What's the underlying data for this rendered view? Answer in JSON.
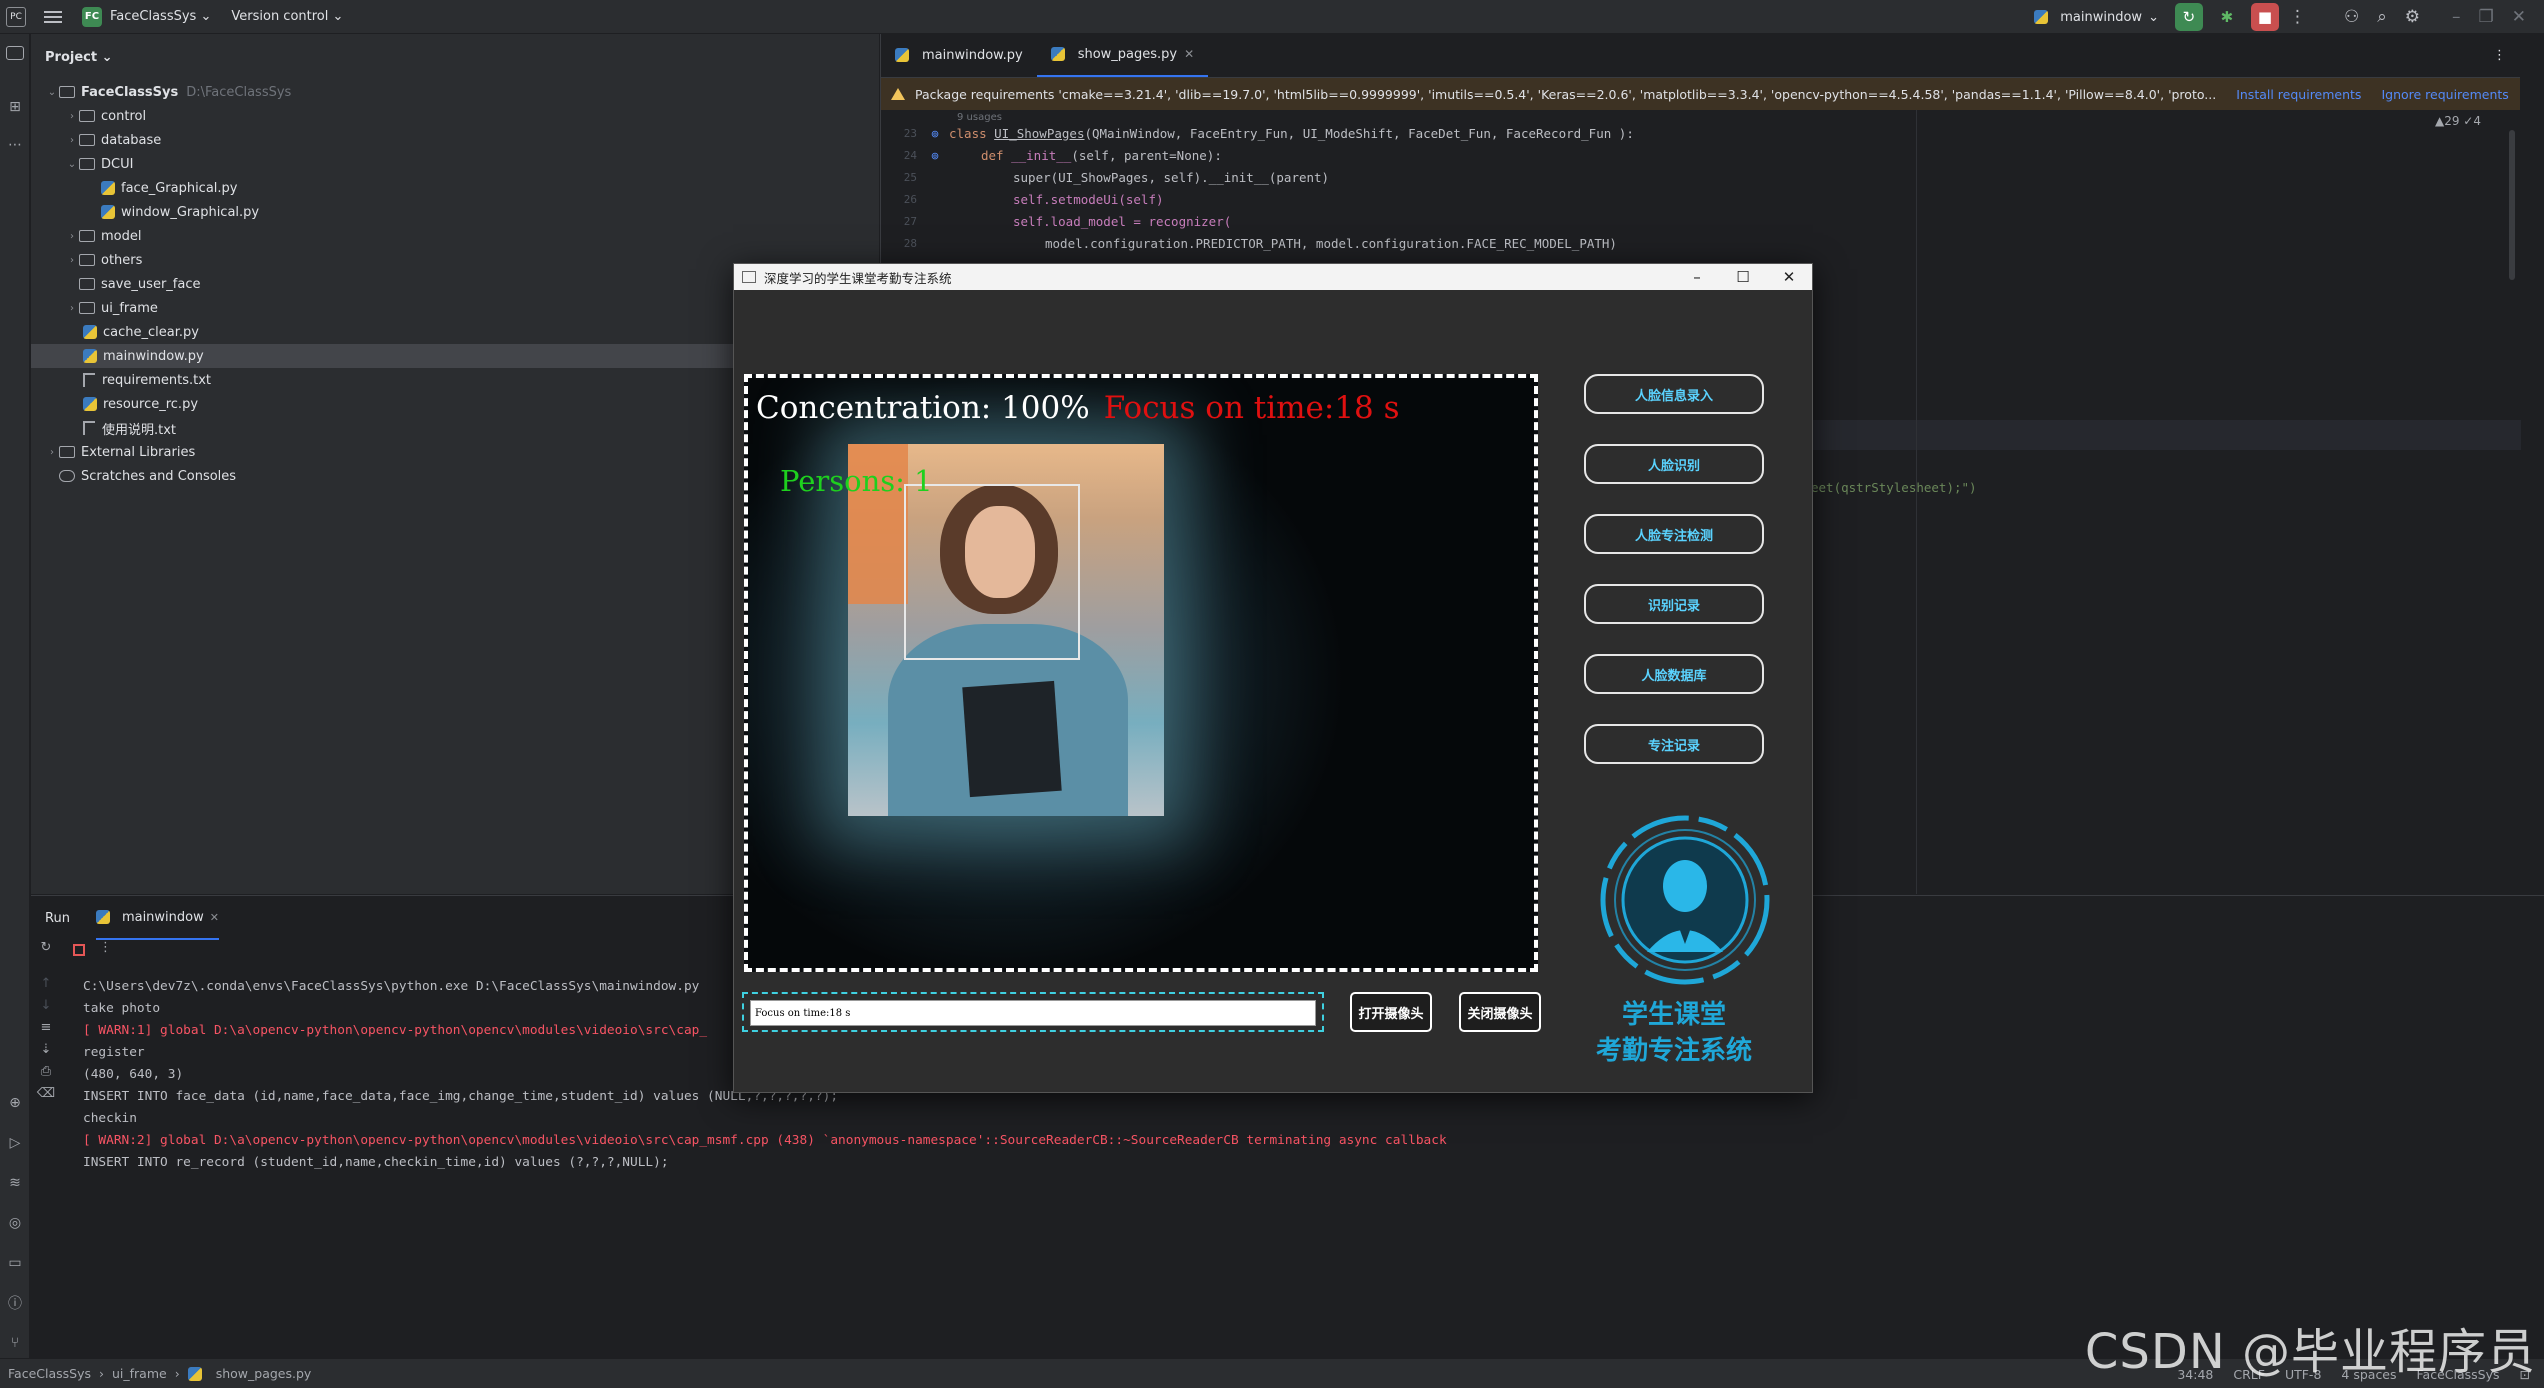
{
  "titlebar": {
    "app_icon": "PC",
    "project_badge": "FC",
    "project_name": "FaceClassSys",
    "version_control": "Version control",
    "run_config": "mainwindow"
  },
  "project_panel": {
    "header": "Project",
    "root_name": "FaceClassSys",
    "root_path": "D:\\FaceClassSys",
    "items": [
      {
        "label": "control",
        "type": "folder"
      },
      {
        "label": "database",
        "type": "folder"
      },
      {
        "label": "DCUI",
        "type": "folder"
      },
      {
        "label": "face_Graphical.py",
        "type": "py"
      },
      {
        "label": "window_Graphical.py",
        "type": "py"
      },
      {
        "label": "model",
        "type": "folder"
      },
      {
        "label": "others",
        "type": "folder"
      },
      {
        "label": "save_user_face",
        "type": "folder"
      },
      {
        "label": "ui_frame",
        "type": "folder"
      },
      {
        "label": "cache_clear.py",
        "type": "py"
      },
      {
        "label": "mainwindow.py",
        "type": "py"
      },
      {
        "label": "requirements.txt",
        "type": "txt"
      },
      {
        "label": "resource_rc.py",
        "type": "py"
      },
      {
        "label": "使用说明.txt",
        "type": "txt"
      }
    ],
    "external_libraries": "External Libraries",
    "scratches": "Scratches and Consoles"
  },
  "editor": {
    "tabs": [
      {
        "label": "mainwindow.py"
      },
      {
        "label": "show_pages.py"
      }
    ],
    "banner": {
      "text": "Package requirements 'cmake==3.21.4', 'dlib==19.7.0', 'html5lib==0.9999999', 'imutils==0.5.4', 'Keras==2.0.6', 'matplotlib==3.3.4', 'opencv-python==4.5.4.58', 'pandas==1.1.4', 'Pillow==8.4.0', 'proto...",
      "install": "Install requirements",
      "ignore": "Ignore requirements"
    },
    "inspection": "▲29 ✓4",
    "usages": "9 usages",
    "code": {
      "l1_kw": "class ",
      "l1_name": "UI_ShowPages",
      "l1_rest": "(QMainWindow, FaceEntry_Fun, UI_ModeShift, FaceDet_Fun, FaceRecord_Fun ):",
      "l2_kw": "def ",
      "l2_name": "__init__",
      "l2_self": "(self, parent=None):",
      "l3": "super(UI_ShowPages, self).__init__(parent)",
      "l4": "self.setmodeUi(self)",
      "l5": "self.load_model = recognizer(",
      "l6": "model.configuration.PREDICTOR_PATH, model.configuration.FACE_REC_MODEL_PATH)",
      "stylesheet_fragment": "eet(qstrStylesheet);\")"
    },
    "line_numbers": [
      "23",
      "24",
      "25",
      "26",
      "27",
      "28"
    ]
  },
  "run_panel": {
    "label": "Run",
    "tab": "mainwindow",
    "console": [
      {
        "text": "C:\\Users\\dev7z\\.conda\\envs\\FaceClassSys\\python.exe D:\\FaceClassSys\\mainwindow.py",
        "kind": "ok"
      },
      {
        "text": "take photo",
        "kind": "ok"
      },
      {
        "text": "[ WARN:1] global D:\\a\\opencv-python\\opencv-python\\opencv\\modules\\videoio\\src\\cap_",
        "kind": "err"
      },
      {
        "text": "register",
        "kind": "ok"
      },
      {
        "text": "(480, 640, 3)",
        "kind": "ok"
      },
      {
        "text": "INSERT INTO face_data (id,name,face_data,face_img,change_time,student_id) values (NULL,?,?,?,?,?);",
        "kind": "ok"
      },
      {
        "text": "checkin",
        "kind": "ok"
      },
      {
        "text": "[ WARN:2] global D:\\a\\opencv-python\\opencv-python\\opencv\\modules\\videoio\\src\\cap_msmf.cpp (438) `anonymous-namespace'::SourceReaderCB::~SourceReaderCB terminating async callback",
        "kind": "err"
      },
      {
        "text": "INSERT INTO re_record (student_id,name,checkin_time,id) values (?,?,?,NULL);",
        "kind": "ok"
      }
    ]
  },
  "statusbar": {
    "crumb1": "FaceClassSys",
    "crumb2": "ui_frame",
    "crumb3": "show_pages.py",
    "position": "34:48",
    "line_sep": "CRLF",
    "encoding": "UTF-8",
    "indent": "4 spaces",
    "interpreter": "FaceClassSys"
  },
  "watermark": "CSDN @毕业程序员",
  "dialog": {
    "title": "深度学习的学生课堂考勤专注系统",
    "overlay_concentration": "Concentration: 100%",
    "overlay_focus": "Focus on time:18 s",
    "overlay_persons": "Persons: 1",
    "status_text": "Focus on time:18 s",
    "open_camera": "打开摄像头",
    "close_camera": "关闭摄像头",
    "side_buttons": [
      {
        "label": "人脸信息录入"
      },
      {
        "label": "人脸识别"
      },
      {
        "label": "人脸专注检测"
      },
      {
        "label": "识别记录"
      },
      {
        "label": "人脸数据库"
      },
      {
        "label": "专注记录"
      }
    ],
    "logo_line1": "学生课堂",
    "logo_line2": "考勤专注系统",
    "accent_color": "#1fa7d8"
  }
}
